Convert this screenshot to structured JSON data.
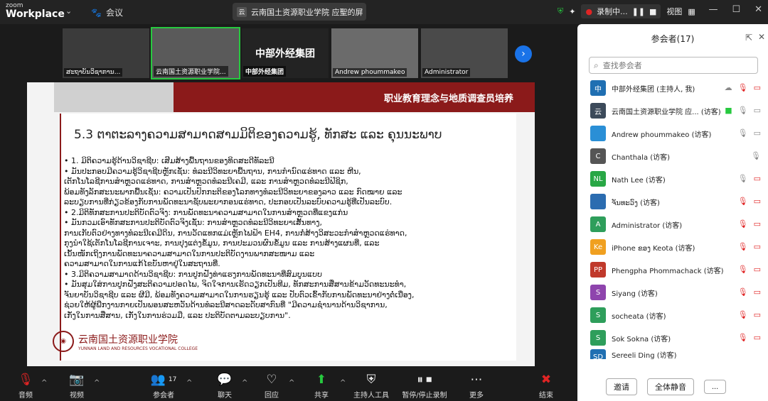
{
  "app": {
    "brand_small": "zoom",
    "brand": "Workplace",
    "meeting_tab": "会议",
    "window_title": "云南国土资源职业学院 应聖的屏",
    "window_title_badge": "云"
  },
  "top": {
    "recording": "录制中...",
    "view": "视图"
  },
  "thumbs": [
    {
      "name": "ສະຖາບັນວິຊາການ...",
      "active": false,
      "text": ""
    },
    {
      "name": "云南国土资源职业学院...",
      "active": true,
      "text": ""
    },
    {
      "name": "中部外经集团",
      "active": false,
      "text": "中部外经集团"
    },
    {
      "name": "Andrew phoummakeo",
      "active": false,
      "text": ""
    },
    {
      "name": "Administrator",
      "active": false,
      "text": ""
    }
  ],
  "slide": {
    "header": "职业教育理念与地质调查员培养",
    "title": "5.3 ຕາຕະລາງຄວາມສາມາດສາມມິຕິຂອງຄວາມຮູ້, ທັກສະ ແລະ ຄຸນນະພາບ",
    "lines": [
      "•    1. ມິຕິຄວາມຮູ້ດ້ານວິຊາຊີບ: ເສີມສ້າງພື້ນຖານຂອງທິດສະດີທັລະນີ",
      "•   ມັນປະກອບມີຄວາມຮູ້ວິຊາຊີບຫຼັກເຊັ່ນ: ທໍລະນີວິທະຍາພື້ນຖານ, ການກຳນົດແຮ່ທາດ ແລະ ຫີນ,",
      "    ເຕັກໂນໂລຊີການສຳຫຼວດແຮ່ທາດ, ການສຳຫຼວດທໍລະນີເຄມີ, ແລະ ການສຳຫຼວດທໍລະນີຟີຊິກ,",
      "    ພ້ອມທັງລັກສະນະພາກພື້ນເຊັ່ນ: ຄວາມເປັນປົກກະຕິຂອງໂລກທາງທໍລະນີວິທະຍາຂອງລາວ ແລະ ກົດໝາຍ ແລະ",
      "    ລະບຽບການທີ່ກ່ຽວຂ້ອງກັບການພັດທະນາຊັບພະຍາກອນແຮ່ທາດ, ປະກອບເປັນລະບົບຄວາມຮູ້ທີ່ເປັນລະບົບ.",
      "•   2.ມິຕິທັກສະການປະຕິບັດຕົວຈິງ: ການພັດທະນາຄວາມສາມາດໃນການສຳຫຼວດທີ່ແຂງແກ່ນ",
      "•   ມັນກວມເອົາທັກສະການປະຕິບັດຕົວຈິງເຊັ່ນ: ການສຳຫຼວດທໍລະນີວິທະຍາເສັ້ນທາງ,",
      "    ການເກັບຕົວຢ່າງທາງທໍລະນີເຄມີດິນ, ການວັດແທກແມ່ເຫຼັກໄຟຟ້າ EH4, ການກໍ່ສ້າງວິສະວະກຳສຳຫຼວດແຮ່ທາດ,",
      "    ກຸງນຳໃຊ້ເຕັກໂນໂລຊີການເຈາະ, ການປຸງແຕ່ງຂໍ້ມູນ, ການປະມວນຜົນຂໍ້ມູນ ແລະ ການສ້າງແຜນທີ່, ແລະ",
      "    ເນັ້ນໜັກເຖິງການພັດທະນາຄວາມສາມາດໃນການປະຕິບັດງານພາກສະໜາມ ແລະ",
      "    ຄວາມສາມາດໃນການແກ້ໄຂບັນຫາຢູ່ໃນສະຖານທີ່.",
      "•   3.ມິຕິຄວາມສາມາດດ້ານວິຊາຊີບ: ການປູກຝັງທ່າແຮງການພັດທະນາທີ່ສົມບູນແບບ",
      "•   ມັນສຸມໃສ່ການປູກຝັງສະຕິຄວາມປອດໄພ, ຈິດໃຈການເຮັດວຽກເປັນທີມ, ທັກສະການສື່ສານຂ້າມວັດທະນະທຳ,",
      "    ຈັນຍາບັນວິຊາຊີບ ແລະ ຜີມີ, ພ້ອມທັງຄວາມສາມາດໃນການຮຽນຮູ້ ແລະ ປັບຕົວເຂົ້າກັບການພັດທະນາຢ່າງຕໍ່ເນື່ອງ,",
      "    ຊ່ວຍໃຫ້ຜູ້ພືກງານກາຍເປັນພອນສະຫວັນດ້ານທໍລະນີສາດລະດັບສາກົນທີ່ \"ມີຄວາມຊຳນານດ້ານວິຊາການ,",
      "    ເກັ່ງໃນການສື່ສານ, ເກັ່ງໃນການຮ່ວມມື, ແລະ ປະຕິບັດຕາມລະບຽບການ\"."
    ],
    "school_cn": "云南国土资源职业学院",
    "school_en": "YUNNAN LAND AND RESOURCES VOCATIONAL COLLEGE"
  },
  "toolbar": {
    "audio": "音频",
    "video": "视频",
    "participants": "参会者",
    "participants_count": "17",
    "chat": "聊天",
    "react": "回应",
    "share": "共享",
    "host_tools": "主持人工具",
    "record": "暂停/停止录制",
    "more": "更多",
    "end": "结束"
  },
  "panel": {
    "title": "参会者(17)",
    "search_placeholder": "查找参会者",
    "participants": [
      {
        "avatar": "中",
        "name": "中部外经集团 (主持人, 我)",
        "color": "#1f6fb2"
      },
      {
        "avatar": "云",
        "name": "云南国土资源职业学院 应... (访客)",
        "color": "#3c4a5a"
      },
      {
        "avatar": "",
        "name": "Andrew phoummakeo (访客)",
        "color": "#2a8fd6"
      },
      {
        "avatar": "C",
        "name": "Chanthala (访客)",
        "color": "#555555"
      },
      {
        "avatar": "NL",
        "name": "Nath Lee (访客)",
        "color": "#28a745"
      },
      {
        "avatar": "",
        "name": "ຈັນທະວົງ (访客)",
        "color": "#2b6cb0"
      },
      {
        "avatar": "A",
        "name": "Administrator (访客)",
        "color": "#2e9e5b"
      },
      {
        "avatar": "Ke",
        "name": "iPhone ຂອງ Keota (访客)",
        "color": "#f0a020"
      },
      {
        "avatar": "PP",
        "name": "Phengpha Phommachack (访客)",
        "color": "#c0392b"
      },
      {
        "avatar": "S",
        "name": "Siyang (访客)",
        "color": "#8e44ad"
      },
      {
        "avatar": "S",
        "name": "socheata (访客)",
        "color": "#2e9e5b"
      },
      {
        "avatar": "S",
        "name": "Sok Sokna (访客)",
        "color": "#2e9e5b"
      },
      {
        "avatar": "SD",
        "name": "Sereeli Ding (访客)",
        "color": "#1f6fb2"
      }
    ],
    "invite": "邀请",
    "mute_all": "全体静音",
    "more": "..."
  }
}
